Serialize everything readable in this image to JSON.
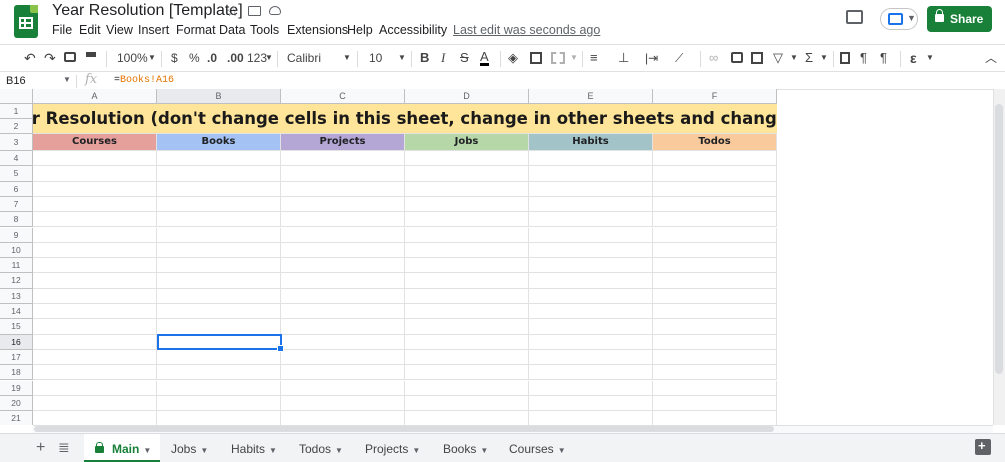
{
  "header": {
    "title": "Year Resolution [Template]",
    "last_edit": "Last edit was seconds ago",
    "share_label": "Share",
    "menu": [
      "File",
      "Edit",
      "View",
      "Insert",
      "Format",
      "Data",
      "Tools",
      "Extensions",
      "Help",
      "Accessibility"
    ]
  },
  "toolbar": {
    "zoom": "100%",
    "currency": "$",
    "percent": "%",
    "decrease_decimals": ".0",
    "increase_decimals": ".00",
    "more_formats": "123",
    "font": "Calibri",
    "font_size": "10"
  },
  "formula_bar": {
    "name_box": "B16",
    "fx": "fx",
    "formula_eq": "=",
    "formula_ref": "Books!A16"
  },
  "sheet": {
    "columns": [
      "A",
      "B",
      "C",
      "D",
      "E",
      "F"
    ],
    "rows": [
      "1",
      "2",
      "3",
      "4",
      "5",
      "6",
      "7",
      "8",
      "9",
      "10",
      "11",
      "12",
      "13",
      "14",
      "15",
      "16",
      "17",
      "18",
      "19",
      "20",
      "21"
    ],
    "banner": "Year Resolution (don't change cells in this sheet, change in other sheets and changes will be reflected here",
    "headers": [
      "Courses",
      "Books",
      "Projects",
      "Jobs",
      "Habits",
      "Todos"
    ],
    "header_colors": [
      "#e6a09c",
      "#a4c2f4",
      "#b4a7d6",
      "#b6d7a8",
      "#a2c4c9",
      "#f9cb9c"
    ],
    "selected_cell": "B16"
  },
  "tabs": [
    "Main",
    "Jobs",
    "Habits",
    "Todos",
    "Projects",
    "Books",
    "Courses"
  ],
  "colors": {
    "brand_green": "#188038",
    "selection_blue": "#1a73e8",
    "banner_yellow": "#ffe599"
  }
}
